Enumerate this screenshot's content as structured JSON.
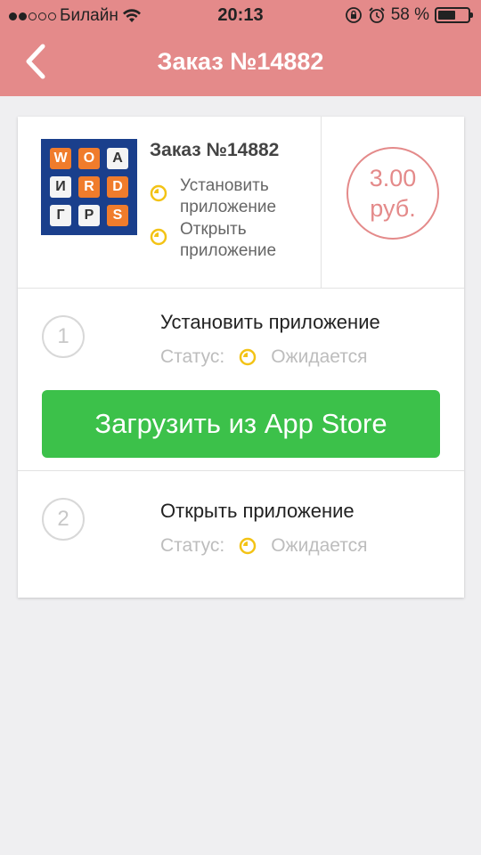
{
  "status_bar": {
    "carrier": "Билайн",
    "time": "20:13",
    "battery_percent": "58 %",
    "battery_level": 0.58
  },
  "nav": {
    "title": "Заказ №14882",
    "back_icon": "chevron-left-icon"
  },
  "order": {
    "title": "Заказ №14882",
    "tasks": [
      {
        "label_line1": "Установить",
        "label_line2": "приложение",
        "icon": "clock-icon"
      },
      {
        "label_line1": "Открыть",
        "label_line2": "приложение",
        "icon": "clock-icon"
      }
    ],
    "price_value": "3.00",
    "price_unit": "руб.",
    "app_icon_letters": [
      "W",
      "O",
      "A",
      "И",
      "R",
      "D",
      "Г",
      "P",
      "S"
    ]
  },
  "steps": [
    {
      "number": "1",
      "title": "Установить приложение",
      "status_label": "Статус:",
      "status_value": "Ожидается"
    },
    {
      "number": "2",
      "title": "Открыть приложение",
      "status_label": "Статус:",
      "status_value": "Ожидается"
    }
  ],
  "download_button": "Загрузить из App Store",
  "colors": {
    "header": "#e48a8a",
    "accent_button": "#3cc14a",
    "pending_icon": "#f3c316"
  }
}
